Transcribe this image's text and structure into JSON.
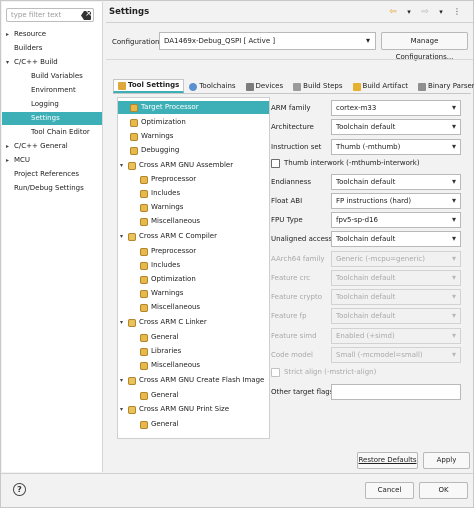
{
  "sidebar": {
    "filter_placeholder": "type filter text",
    "items": [
      {
        "label": "Resource",
        "arrow": "▸"
      },
      {
        "label": "Builders",
        "arrow": ""
      },
      {
        "label": "C/C++ Build",
        "arrow": "▾"
      },
      {
        "label": "Build Variables",
        "arrow": ""
      },
      {
        "label": "Environment",
        "arrow": ""
      },
      {
        "label": "Logging",
        "arrow": ""
      },
      {
        "label": "Settings",
        "arrow": ""
      },
      {
        "label": "Tool Chain Editor",
        "arrow": ""
      },
      {
        "label": "C/C++ General",
        "arrow": "▸"
      },
      {
        "label": "MCU",
        "arrow": "▸"
      },
      {
        "label": "Project References",
        "arrow": ""
      },
      {
        "label": "Run/Debug Settings",
        "arrow": ""
      }
    ]
  },
  "header": {
    "title": "Settings",
    "icons": [
      "back-arrow-icon",
      "dropdown-icon",
      "forward-arrow-icon",
      "dropdown-icon",
      "menu-icon"
    ]
  },
  "configuration": {
    "label": "Configuration:",
    "value": "DA1469x-Debug_QSPI  [ Active ]",
    "manage_button": "Manage Configurations..."
  },
  "tabs": [
    {
      "label": "Tool Settings",
      "icon": "tool-settings-icon",
      "active": true
    },
    {
      "label": "Toolchains",
      "icon": "toolchains-icon"
    },
    {
      "label": "Devices",
      "icon": "devices-icon"
    },
    {
      "label": "Build Steps",
      "icon": "build-steps-icon"
    },
    {
      "label": "Build Artifact",
      "icon": "build-artifact-icon"
    },
    {
      "label": "Binary Parsers",
      "icon": "binary-parsers-icon"
    }
  ],
  "tree": [
    {
      "label": "Target Processor",
      "selected": true
    },
    {
      "label": "Optimization"
    },
    {
      "label": "Warnings"
    },
    {
      "label": "Debugging"
    },
    {
      "label": "Cross ARM GNU Assembler",
      "expanded": true
    },
    {
      "label": "Preprocessor"
    },
    {
      "label": "Includes"
    },
    {
      "label": "Warnings"
    },
    {
      "label": "Miscellaneous"
    },
    {
      "label": "Cross ARM C Compiler",
      "expanded": true
    },
    {
      "label": "Preprocessor"
    },
    {
      "label": "Includes"
    },
    {
      "label": "Optimization"
    },
    {
      "label": "Warnings"
    },
    {
      "label": "Miscellaneous"
    },
    {
      "label": "Cross ARM C Linker",
      "expanded": true
    },
    {
      "label": "General"
    },
    {
      "label": "Libraries"
    },
    {
      "label": "Miscellaneous"
    },
    {
      "label": "Cross ARM GNU Create Flash Image",
      "expanded": true
    },
    {
      "label": "General"
    },
    {
      "label": "Cross ARM GNU Print Size",
      "expanded": true
    },
    {
      "label": "General"
    }
  ],
  "options": {
    "arm_family": {
      "label": "ARM family",
      "value": "cortex-m33"
    },
    "architecture": {
      "label": "Architecture",
      "value": "Toolchain default"
    },
    "instruction_set": {
      "label": "Instruction set",
      "value": "Thumb (-mthumb)"
    },
    "thumb_interwork": {
      "label": "Thumb interwork (-mthumb-interwork)",
      "checked": false
    },
    "endianness": {
      "label": "Endianness",
      "value": "Toolchain default"
    },
    "float_abi": {
      "label": "Float ABI",
      "value": "FP instructions (hard)"
    },
    "fpu_type": {
      "label": "FPU Type",
      "value": "fpv5-sp-d16"
    },
    "unaligned_access": {
      "label": "Unaligned access",
      "value": "Toolchain default"
    },
    "aarch64_family": {
      "label": "AArch64 family",
      "value": "Generic (-mcpu=generic)"
    },
    "feature_crc": {
      "label": "Feature crc",
      "value": "Toolchain default"
    },
    "feature_crypto": {
      "label": "Feature crypto",
      "value": "Toolchain default"
    },
    "feature_fp": {
      "label": "Feature fp",
      "value": "Toolchain default"
    },
    "feature_simd": {
      "label": "Feature simd",
      "value": "Enabled (+simd)"
    },
    "code_model": {
      "label": "Code model",
      "value": "Small (-mcmodel=small)"
    },
    "strict_align": {
      "label": "Strict align (-mstrict-align)",
      "checked": false
    },
    "other_target_flags": {
      "label": "Other target flags",
      "value": ""
    }
  },
  "buttons": {
    "restore_defaults": "Restore Defaults",
    "apply": "Apply",
    "cancel": "Cancel",
    "ok": "OK",
    "help": "?"
  },
  "colors": {
    "accent": "#3db0b7"
  }
}
